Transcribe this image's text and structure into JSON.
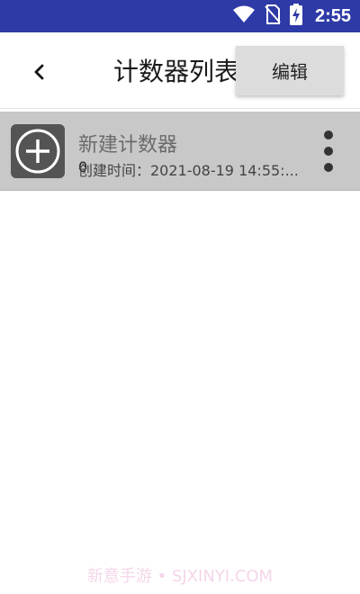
{
  "status_bar": {
    "time": "2:55",
    "icons": [
      "wifi-icon",
      "no-sim-icon",
      "battery-charging-icon"
    ]
  },
  "toolbar": {
    "back_icon": "chevron-left-icon",
    "title": "计数器列表"
  },
  "menu": {
    "items": [
      {
        "label": "编辑"
      }
    ]
  },
  "counters": [
    {
      "icon": "add-circle-icon",
      "title": "新建计数器",
      "count": "0",
      "created": "创建时间：2021-08-19 14:55:...",
      "more_icon": "more-vertical-icon"
    }
  ],
  "watermark": "新意手游 • SJXINYI.COM",
  "colors": {
    "status_bar": "#2e3aa6",
    "item_background": "#c8c8c8",
    "item_icon_background": "#545454",
    "menu_background": "#dcdcdc"
  }
}
